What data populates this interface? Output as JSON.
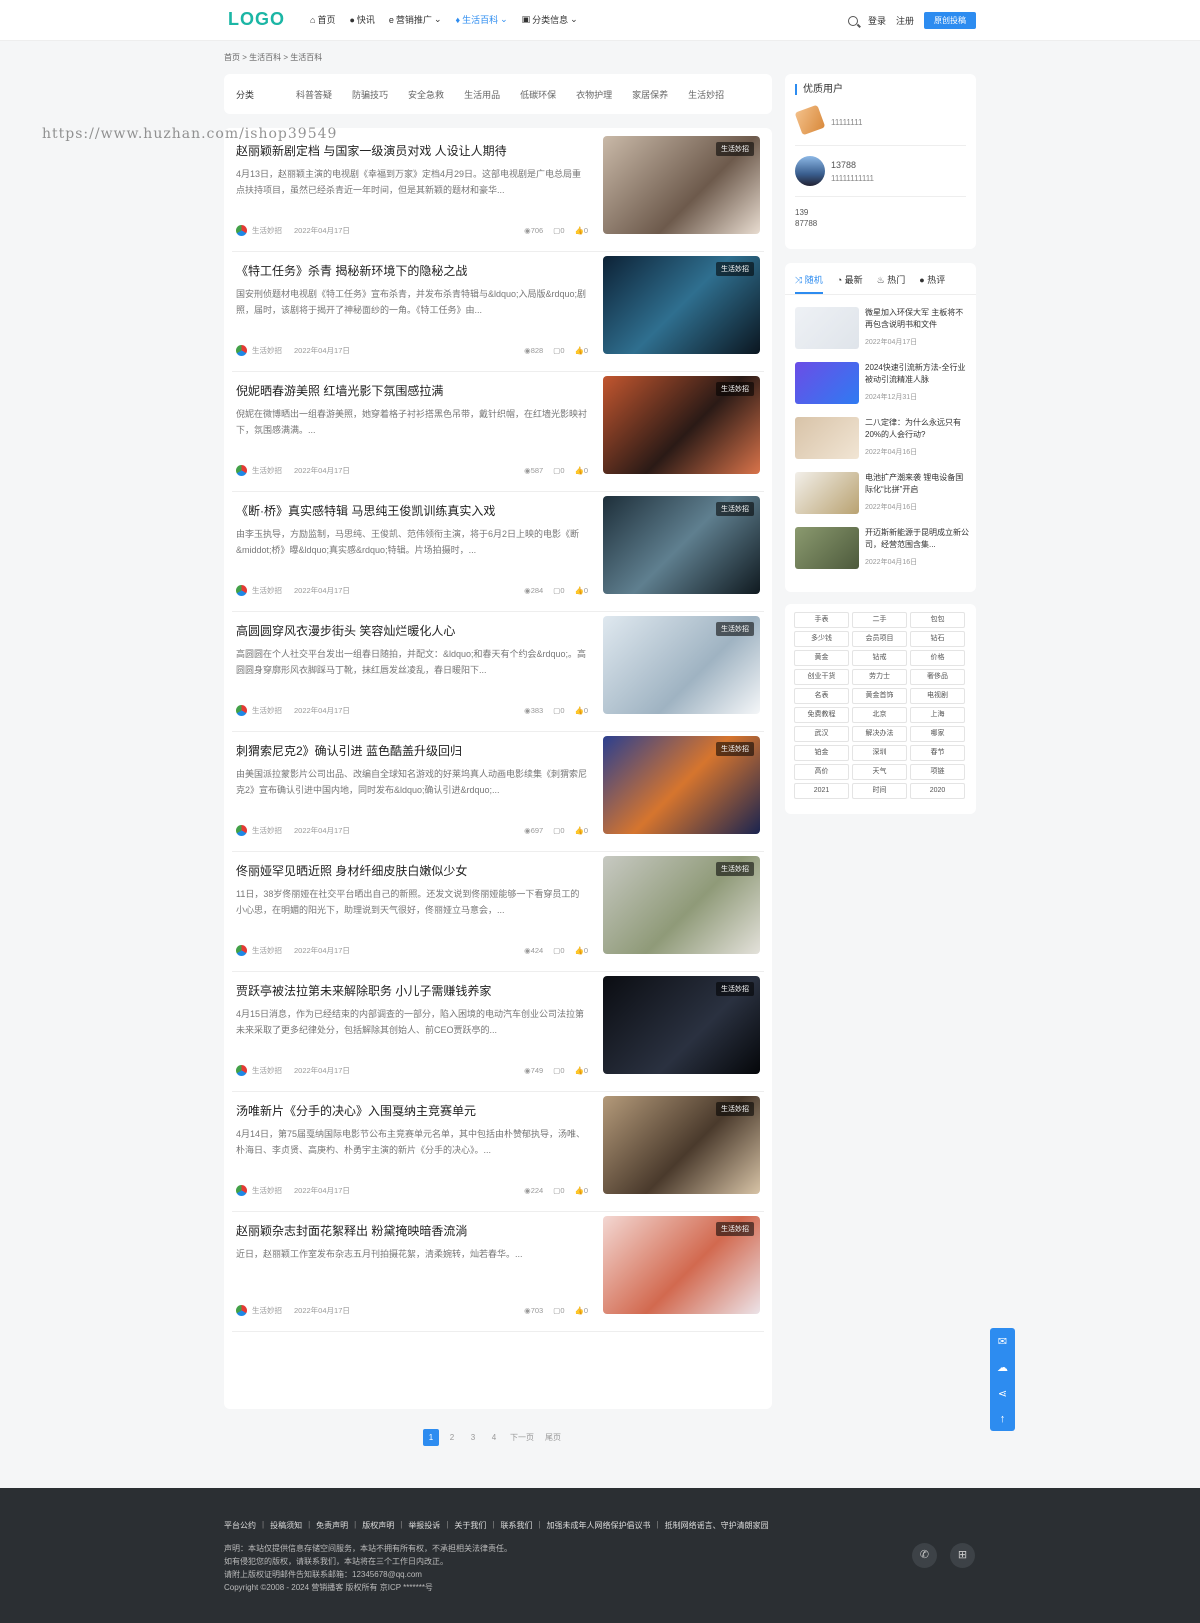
{
  "header": {
    "logo": "LOGO",
    "nav": [
      {
        "label": "首页",
        "icon": "home-icon"
      },
      {
        "label": "快讯",
        "icon": "chat-icon"
      },
      {
        "label": "营销推广",
        "icon": "ie-icon"
      },
      {
        "label": "生活百科",
        "icon": "bell-icon"
      },
      {
        "label": "分类信息",
        "icon": "box-icon"
      }
    ],
    "login": "登录",
    "register": "注册",
    "post": "原创投稿"
  },
  "breadcrumb": "首页 > 生活百科 > 生活百科",
  "categories": {
    "label": "分类",
    "items": [
      "科普答疑",
      "防骗技巧",
      "安全急救",
      "生活用品",
      "低碳环保",
      "衣物护理",
      "家居保养",
      "生活妙招"
    ]
  },
  "watermark": "https://www.huzhan.com/ishop39549",
  "articles": [
    {
      "title": "赵丽颖新剧定档 与国家一级演员对戏 人设让人期待",
      "excerpt": "4月13日，赵丽颖主演的电视剧《幸福到万家》定档4月29日。这部电视剧是广电总局重点扶持项目，虽然已经杀青近一年时间，但是其新颖的题材和豪华...",
      "category": "生活妙招",
      "date": "2022年04月17日",
      "views": "706",
      "comments": "0",
      "likes": "0",
      "tag": "生活妙招"
    },
    {
      "title": "《特工任务》杀青 揭秘新环境下的隐秘之战",
      "excerpt": "国安刑侦题材电视剧《特工任务》宣布杀青，并发布杀青特辑与&ldquo;入局版&rdquo;剧照，届时，该剧将于揭开了神秘面纱的一角。《特工任务》由...",
      "category": "生活妙招",
      "date": "2022年04月17日",
      "views": "828",
      "comments": "0",
      "likes": "0",
      "tag": "生活妙招"
    },
    {
      "title": "倪妮晒春游美照 红墙光影下氛围感拉满",
      "excerpt": "倪妮在微博晒出一组春游美照，她穿着格子衬衫搭黑色吊带，戴针织帽，在红墙光影映衬下，氛围感满满。...",
      "category": "生活妙招",
      "date": "2022年04月17日",
      "views": "587",
      "comments": "0",
      "likes": "0",
      "tag": "生活妙招"
    },
    {
      "title": "《断·桥》真实感特辑 马思纯王俊凯训练真实入戏",
      "excerpt": "由李玉执导，方励监制，马思纯、王俊凯、范伟领衔主演，将于6月2日上映的电影《断&middot;桥》曝&ldquo;真实感&rdquo;特辑。片场拍摄时，...",
      "category": "生活妙招",
      "date": "2022年04月17日",
      "views": "284",
      "comments": "0",
      "likes": "0",
      "tag": "生活妙招"
    },
    {
      "title": "高圆圆穿风衣漫步街头 笑容灿烂暖化人心",
      "excerpt": "高圆圆在个人社交平台发出一组春日随拍，并配文：&ldquo;和春天有个约会&rdquo;。高圆圆身穿廓形风衣脚踩马丁靴，抹红唇发丝凌乱，春日暖阳下...",
      "category": "生活妙招",
      "date": "2022年04月17日",
      "views": "383",
      "comments": "0",
      "likes": "0",
      "tag": "生活妙招"
    },
    {
      "title": "刺猬索尼克2》确认引进 蓝色酷盖升级回归",
      "excerpt": "由美国派拉蒙影片公司出品、改编自全球知名游戏的好莱坞真人动画电影续集《刺猬索尼克2》宣布确认引进中国内地，同时发布&ldquo;确认引进&rdquo;...",
      "category": "生活妙招",
      "date": "2022年04月17日",
      "views": "697",
      "comments": "0",
      "likes": "0",
      "tag": "生活妙招"
    },
    {
      "title": "佟丽娅罕见晒近照 身材纤细皮肤白嫩似少女",
      "excerpt": "11日，38岁佟丽娅在社交平台晒出自己的新照。还发文说到佟丽娅能够一下看穿员工的小心思，在明媚的阳光下，助理说到天气很好，佟丽娅立马意会，...",
      "category": "生活妙招",
      "date": "2022年04月17日",
      "views": "424",
      "comments": "0",
      "likes": "0",
      "tag": "生活妙招"
    },
    {
      "title": "贾跃亭被法拉第未来解除职务 小儿子需赚钱养家",
      "excerpt": "4月15日消息，作为已经结束的内部调查的一部分，陷入困境的电动汽车创业公司法拉第未来采取了更多纪律处分，包括解除其创始人、前CEO贾跃亭的...",
      "category": "生活妙招",
      "date": "2022年04月17日",
      "views": "749",
      "comments": "0",
      "likes": "0",
      "tag": "生活妙招"
    },
    {
      "title": "汤唯新片《分手的决心》入围戛纳主竞赛单元",
      "excerpt": "4月14日，第75届戛纳国际电影节公布主竞赛单元名单，其中包括由朴赞郁执导，汤唯、朴海日、李贞贤、高庚杓、朴勇宇主演的新片《分手的决心》。...",
      "category": "生活妙招",
      "date": "2022年04月17日",
      "views": "224",
      "comments": "0",
      "likes": "0",
      "tag": "生活妙招"
    },
    {
      "title": "赵丽颖杂志封面花絮释出 粉黛掩映暗香流淌",
      "excerpt": "近日，赵丽颖工作室发布杂志五月刊拍摄花絮，清柔婉转，灿若春华。...",
      "category": "生活妙招",
      "date": "2022年04月17日",
      "views": "703",
      "comments": "0",
      "likes": "0",
      "tag": "生活妙招"
    }
  ],
  "pager": [
    "1",
    "2",
    "3",
    "4",
    "下一页",
    "尾页"
  ],
  "sidebar": {
    "users_title": "优质用户",
    "users": [
      {
        "name": "",
        "id": "11111111"
      },
      {
        "name": "13788",
        "id": "11111111111"
      },
      {
        "name": "139",
        "id": "87788"
      }
    ],
    "tabs": [
      "随机",
      "最新",
      "热门",
      "热评"
    ],
    "posts": [
      {
        "title": "微星加入环保大军 主板将不再包含说明书和文件",
        "date": "2022年04月17日"
      },
      {
        "title": "2024快速引流新方法-全行业被动引流精准人脉",
        "date": "2024年12月31日"
      },
      {
        "title": "二八定律：为什么永远只有20%的人会行动?",
        "date": "2022年04月16日"
      },
      {
        "title": "电池扩产潮来袭 锂电设备国际化“比拼”开启",
        "date": "2022年04月16日"
      },
      {
        "title": "开迈斯新能源于昆明成立新公司，经营范围含集...",
        "date": "2022年04月16日"
      }
    ],
    "tags": [
      "手表",
      "二手",
      "包包",
      "多少钱",
      "会员项目",
      "钻石",
      "黄金",
      "钻戒",
      "价格",
      "创业干货",
      "劳力士",
      "奢侈品",
      "名表",
      "黄金首饰",
      "电视剧",
      "免费教程",
      "北京",
      "上海",
      "武汉",
      "解决办法",
      "哪家",
      "铂金",
      "深圳",
      "春节",
      "高价",
      "天气",
      "项链",
      "2021",
      "时间",
      "2020"
    ]
  },
  "footer": {
    "links": [
      "平台公约",
      "投稿须知",
      "免责声明",
      "版权声明",
      "举报投诉",
      "关于我们",
      "联系我们",
      "加强未成年人网络保护倡议书",
      "抵制网络谣言、守护清朗家园"
    ],
    "notice1": "声明：本站仅提供信息存储空间服务，本站不拥有所有权，不承担相关法律责任。",
    "notice2": "如有侵犯您的版权，请联系我们，本站将在三个工作日内改正。",
    "notice3": "请附上版权证明邮件告知联系邮箱：12345678@qq.com",
    "copyright": "Copyright ©2008 - 2024 营销播客 版权所有 京ICP *******号"
  }
}
